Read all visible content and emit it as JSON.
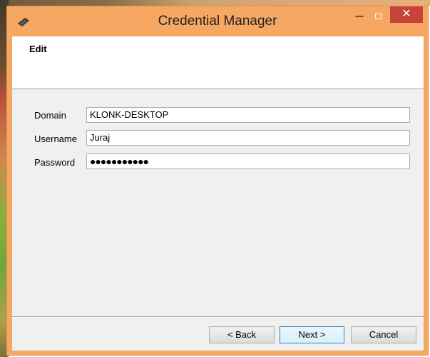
{
  "window": {
    "title": "Credential Manager",
    "minimize_label": "–",
    "close_label": "✕"
  },
  "header": {
    "title": "Edit"
  },
  "form": {
    "domain": {
      "label": "Domain",
      "value": "KLONK-DESKTOP"
    },
    "username": {
      "label": "Username",
      "value": "Juraj"
    },
    "password": {
      "label": "Password",
      "value": "●●●●●●●●●●●"
    }
  },
  "buttons": {
    "back": "< Back",
    "next": "Next >",
    "cancel": "Cancel"
  },
  "colors": {
    "titlebar": "#f6a862",
    "close_button": "#c7423b",
    "client_bg": "#f0f0f0"
  },
  "icons": {
    "app": "credential-key-icon",
    "maximize": "maximize-icon"
  }
}
